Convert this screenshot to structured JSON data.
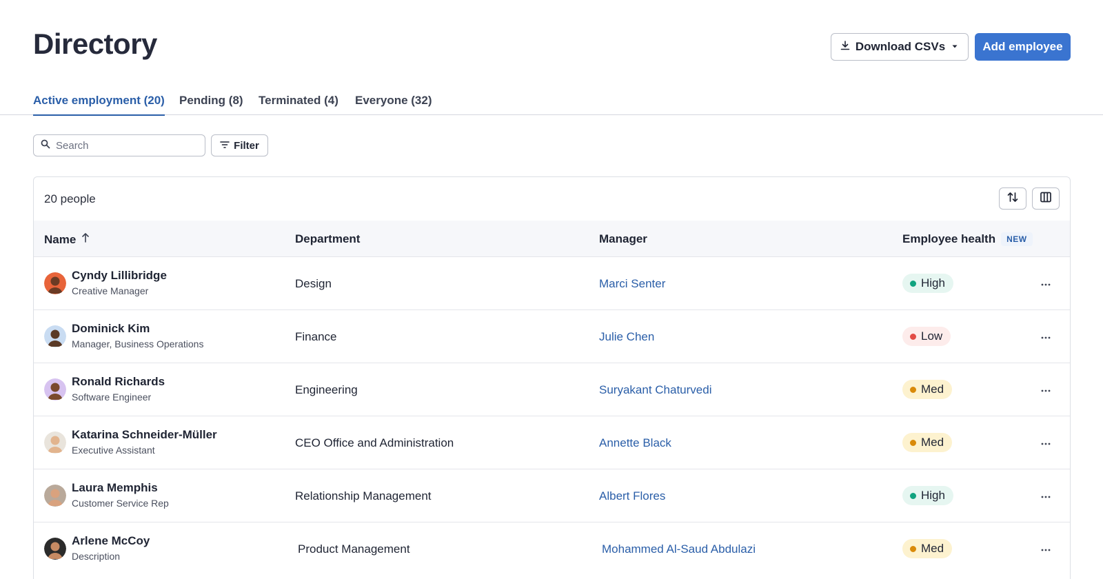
{
  "header": {
    "title": "Directory",
    "download_label": "Download CSVs",
    "add_label": "Add employee"
  },
  "tabs": [
    {
      "label": "Active employment (20)",
      "active": true
    },
    {
      "label": "Pending (8)",
      "active": false
    },
    {
      "label": "Terminated (4)",
      "active": false
    },
    {
      "label": "Everyone (32)",
      "active": false
    }
  ],
  "toolbar": {
    "search_placeholder": "Search",
    "filter_label": "Filter"
  },
  "table": {
    "count_label": "20 people",
    "columns": {
      "name": "Name",
      "department": "Department",
      "manager": "Manager",
      "health": "Employee health",
      "health_badge": "NEW"
    },
    "rows": [
      {
        "name": "Cyndy Lillibridge",
        "title": "Creative Manager",
        "department": "Design",
        "manager": "Marci Senter",
        "health": "High",
        "avatar_bg": "#e8643a",
        "skin": "#6b3b24"
      },
      {
        "name": "Dominick Kim",
        "title": "Manager, Business Operations",
        "department": "Finance",
        "manager": "Julie Chen",
        "health": "Low",
        "avatar_bg": "#c9dcf2",
        "skin": "#5a3a26"
      },
      {
        "name": "Ronald Richards",
        "title": "Software Engineer",
        "department": "Engineering",
        "manager": "Suryakant Chaturvedi",
        "health": "Med",
        "avatar_bg": "#d7c3f0",
        "skin": "#7a4a2e"
      },
      {
        "name": "Katarina Schneider-Müller",
        "title": "Executive Assistant",
        "department": "CEO Office and Administration",
        "manager": "Annette Black",
        "health": "Med",
        "avatar_bg": "#e9e4dc",
        "skin": "#e2b48e"
      },
      {
        "name": "Laura Memphis",
        "title": "Customer Service Rep",
        "department": "Relationship Management",
        "manager": "Albert Flores",
        "health": "High",
        "avatar_bg": "#b9a99a",
        "skin": "#d9a27e"
      },
      {
        "name": "Arlene McCoy",
        "title": "Description",
        "department": "Product Management",
        "manager": "Mohammed Al-Saud Abdulazi",
        "health": "Med",
        "avatar_bg": "#2b2b2b",
        "skin": "#c68a63"
      }
    ]
  },
  "health_colors": {
    "High": {
      "bg": "#e6f6f1",
      "dot": "#10a37f"
    },
    "Low": {
      "bg": "#fdeceb",
      "dot": "#e24b45"
    },
    "Med": {
      "bg": "#fdf2cf",
      "dot": "#d98a0a"
    }
  },
  "colors": {
    "accent": "#3a74d0",
    "link": "#2a5ea8"
  }
}
